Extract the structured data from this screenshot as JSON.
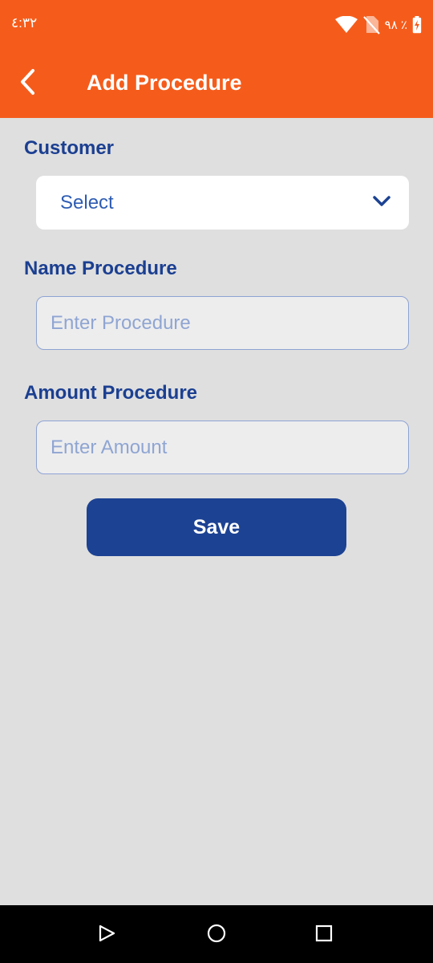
{
  "status_bar": {
    "time": "٤:٣٢",
    "battery_text": "٩٨ ٪",
    "icons": [
      "wifi-icon",
      "no-sim-icon",
      "battery-charging-icon"
    ]
  },
  "app_bar": {
    "title": "Add Procedure",
    "back_icon": "chevron-left-icon"
  },
  "form": {
    "customer": {
      "label": "Customer",
      "selected_value": "Select",
      "dropdown_icon": "chevron-down-icon"
    },
    "name_procedure": {
      "label": "Name Procedure",
      "value": "",
      "placeholder": "Enter Procedure"
    },
    "amount_procedure": {
      "label": "Amount Procedure",
      "value": "",
      "placeholder": "Enter Amount"
    },
    "save_label": "Save"
  },
  "nav_bar": {
    "icons": [
      "back-triangle-icon",
      "home-circle-icon",
      "recents-square-icon"
    ]
  },
  "colors": {
    "header": "#f55c1b",
    "primary": "#1c4293",
    "label": "#1b3f91",
    "background": "#dfdfdf"
  }
}
